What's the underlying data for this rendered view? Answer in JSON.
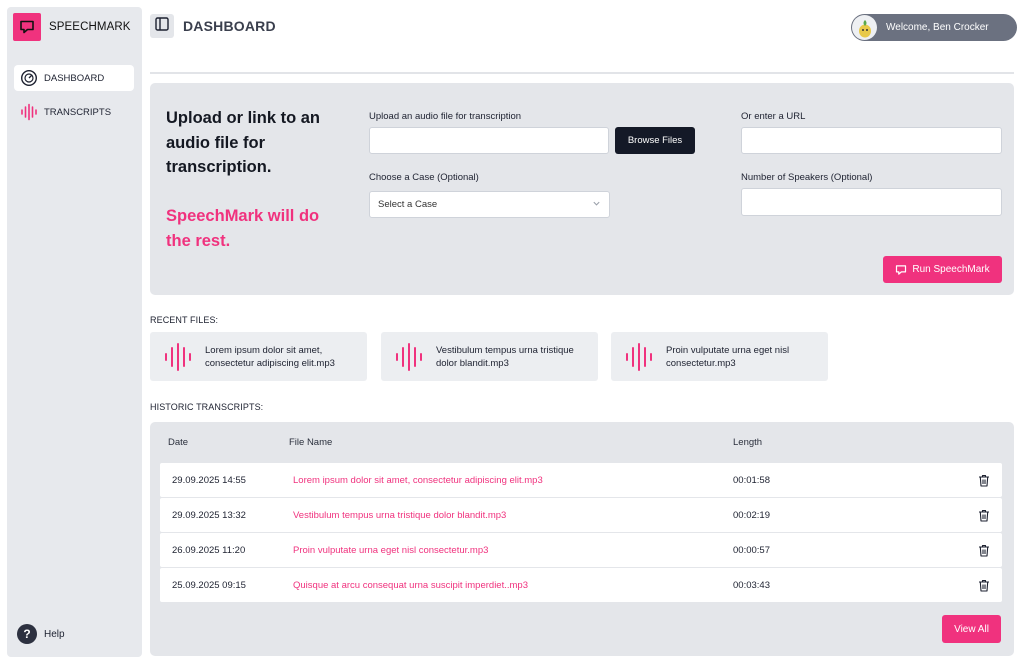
{
  "brand": {
    "name": "SPEECHMARK",
    "accent_color": "#f0327e"
  },
  "sidebar": {
    "items": [
      {
        "label": "DASHBOARD",
        "icon": "gauge-icon",
        "active": true
      },
      {
        "label": "TRANSCRIPTS",
        "icon": "waveform-icon",
        "active": false
      }
    ],
    "help_label": "Help"
  },
  "header": {
    "title": "DASHBOARD",
    "welcome": "Welcome, Ben Crocker"
  },
  "upload": {
    "heading": "Upload or link to an audio file for transcription.",
    "tagline": "SpeechMark will do the rest.",
    "file_label": "Upload an audio file for transcription",
    "file_value": "",
    "browse_label": "Browse Files",
    "url_label": "Or enter a URL",
    "url_value": "",
    "case_label": "Choose a Case (Optional)",
    "case_selected": "Select a Case",
    "speakers_label": "Number of Speakers (Optional)",
    "speakers_value": "",
    "run_label": "Run SpeechMark"
  },
  "recent": {
    "label": "RECENT FILES:",
    "files": [
      "Lorem ipsum dolor sit amet, consectetur adipiscing elit.mp3",
      "Vestibulum tempus urna tristique dolor blandit.mp3",
      "Proin vulputate urna eget nisl consectetur.mp3"
    ]
  },
  "historic": {
    "label": "HISTORIC TRANSCRIPTS:",
    "columns": {
      "date": "Date",
      "name": "File Name",
      "length": "Length"
    },
    "rows": [
      {
        "date": "29.09.2025  14:55",
        "name": "Lorem ipsum dolor sit amet, consectetur adipiscing elit.mp3",
        "length": "00:01:58"
      },
      {
        "date": "29.09.2025  13:32",
        "name": "Vestibulum tempus urna tristique dolor blandit.mp3",
        "length": "00:02:19"
      },
      {
        "date": "26.09.2025  11:20",
        "name": "Proin vulputate urna eget nisl consectetur.mp3",
        "length": "00:00:57"
      },
      {
        "date": "25.09.2025  09:15",
        "name": "Quisque at arcu consequat urna suscipit imperdiet..mp3",
        "length": "00:03:43"
      }
    ],
    "view_all_label": "View All"
  }
}
